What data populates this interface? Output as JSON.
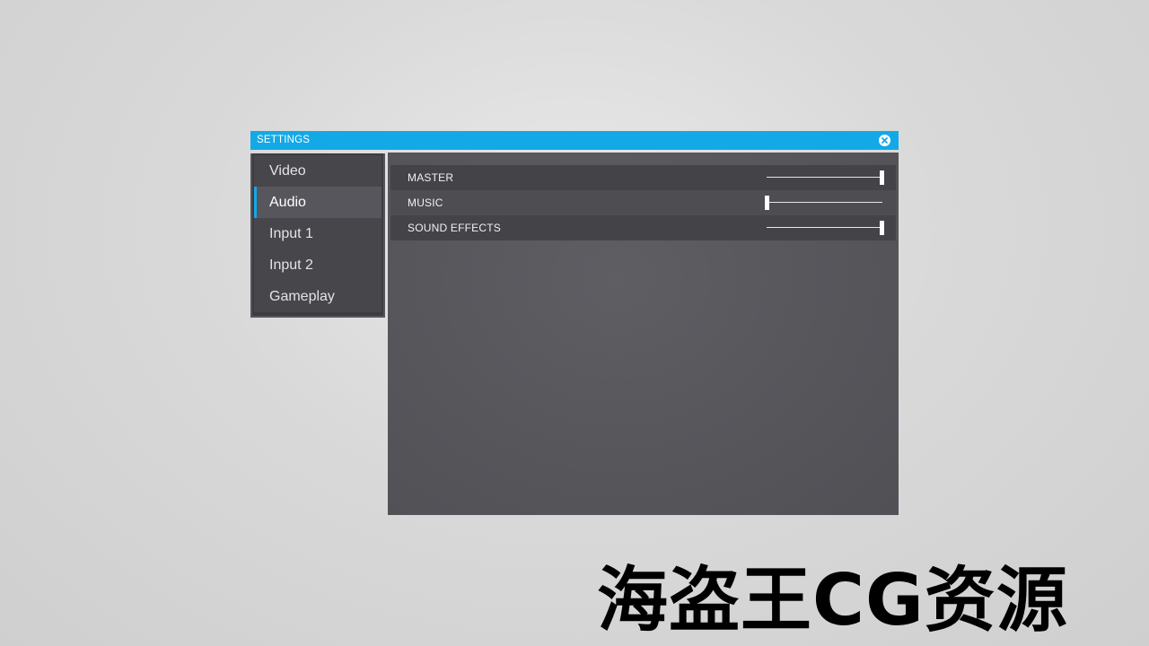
{
  "window": {
    "title": "SETTINGS",
    "close_icon": "close-circle-icon"
  },
  "sidebar": {
    "items": [
      {
        "label": "Video",
        "active": false
      },
      {
        "label": "Audio",
        "active": true
      },
      {
        "label": "Input 1",
        "active": false
      },
      {
        "label": "Input 2",
        "active": false
      },
      {
        "label": "Gameplay",
        "active": false
      }
    ]
  },
  "audio": {
    "settings": [
      {
        "label": "MASTER",
        "value": 1.0
      },
      {
        "label": "MUSIC",
        "value": 0.0
      },
      {
        "label": "SOUND EFFECTS",
        "value": 1.0
      }
    ]
  },
  "colors": {
    "accent": "#13a9e6",
    "panel": "#56565b",
    "sidebar": "#46464b"
  },
  "watermark": {
    "text": "海盗王CG资源"
  }
}
